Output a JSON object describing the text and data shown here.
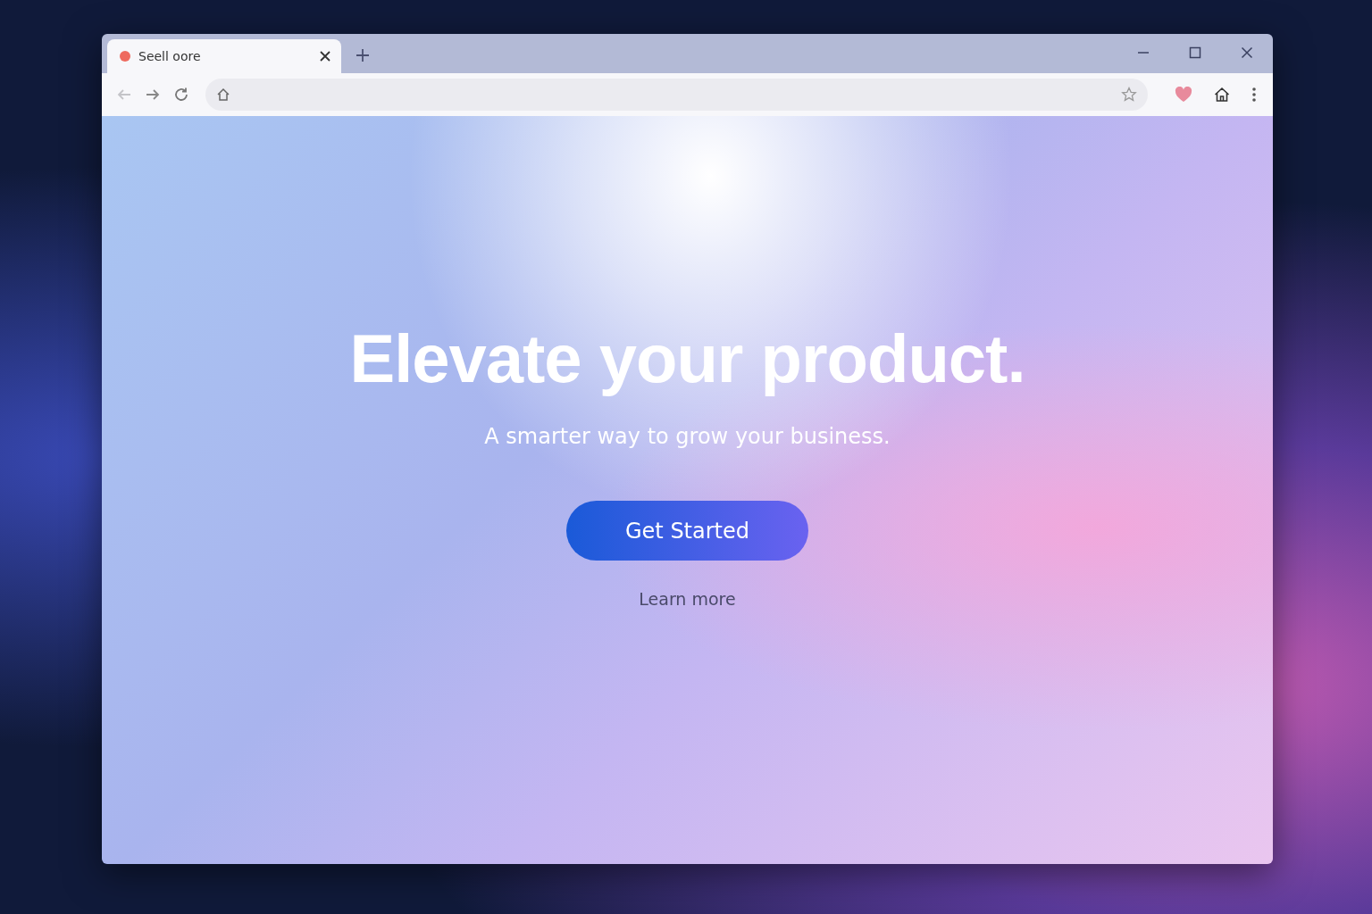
{
  "tab": {
    "title": "Seell oore",
    "selected": true
  },
  "nav": [
    {
      "kind": "back",
      "disabled": true
    },
    {
      "kind": "forward",
      "disabled": false
    },
    {
      "kind": "reload",
      "disabled": false
    }
  ],
  "hero": {
    "heading": "Elevate your product.",
    "subheading": "A smarter way to grow your business.",
    "primary_button": "Get Started",
    "secondary_link": "Learn more"
  }
}
